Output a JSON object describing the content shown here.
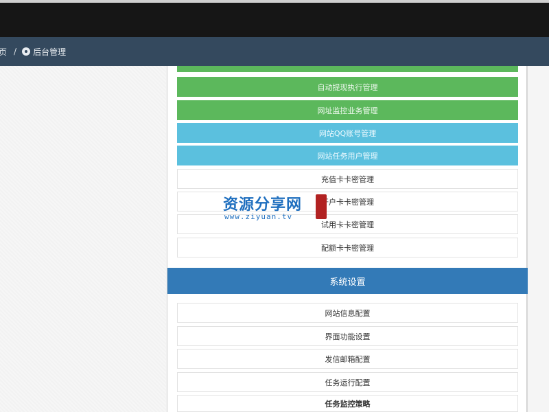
{
  "breadcrumb": {
    "prev": "页",
    "separator": "/",
    "current": "后台管理",
    "icon": "gear-icon"
  },
  "menu": {
    "items": [
      {
        "label": "自动提现执行管理",
        "style": "green"
      },
      {
        "label": "网址监控业务管理",
        "style": "green"
      },
      {
        "label": "网站QQ账号管理",
        "style": "blue"
      },
      {
        "label": "网站任务用户管理",
        "style": "blue"
      },
      {
        "label": "充值卡卡密管理",
        "style": "white"
      },
      {
        "label": "开户卡卡密管理",
        "style": "white"
      },
      {
        "label": "试用卡卡密管理",
        "style": "white"
      },
      {
        "label": "配额卡卡密管理",
        "style": "white"
      }
    ]
  },
  "system_settings": {
    "title": "系统设置",
    "items": [
      {
        "label": "网站信息配置"
      },
      {
        "label": "界面功能设置"
      },
      {
        "label": "发信邮箱配置"
      },
      {
        "label": "任务运行配置"
      },
      {
        "label": "任务监控策略"
      }
    ]
  },
  "watermark": {
    "main": "资源分享网",
    "sub": "www.ziyuan.tv"
  },
  "colors": {
    "green": "#5cb85c",
    "blue": "#5bc0de",
    "primary": "#337ab7",
    "breadcrumb_bg": "#34495e",
    "topbar_bg": "#161616"
  }
}
